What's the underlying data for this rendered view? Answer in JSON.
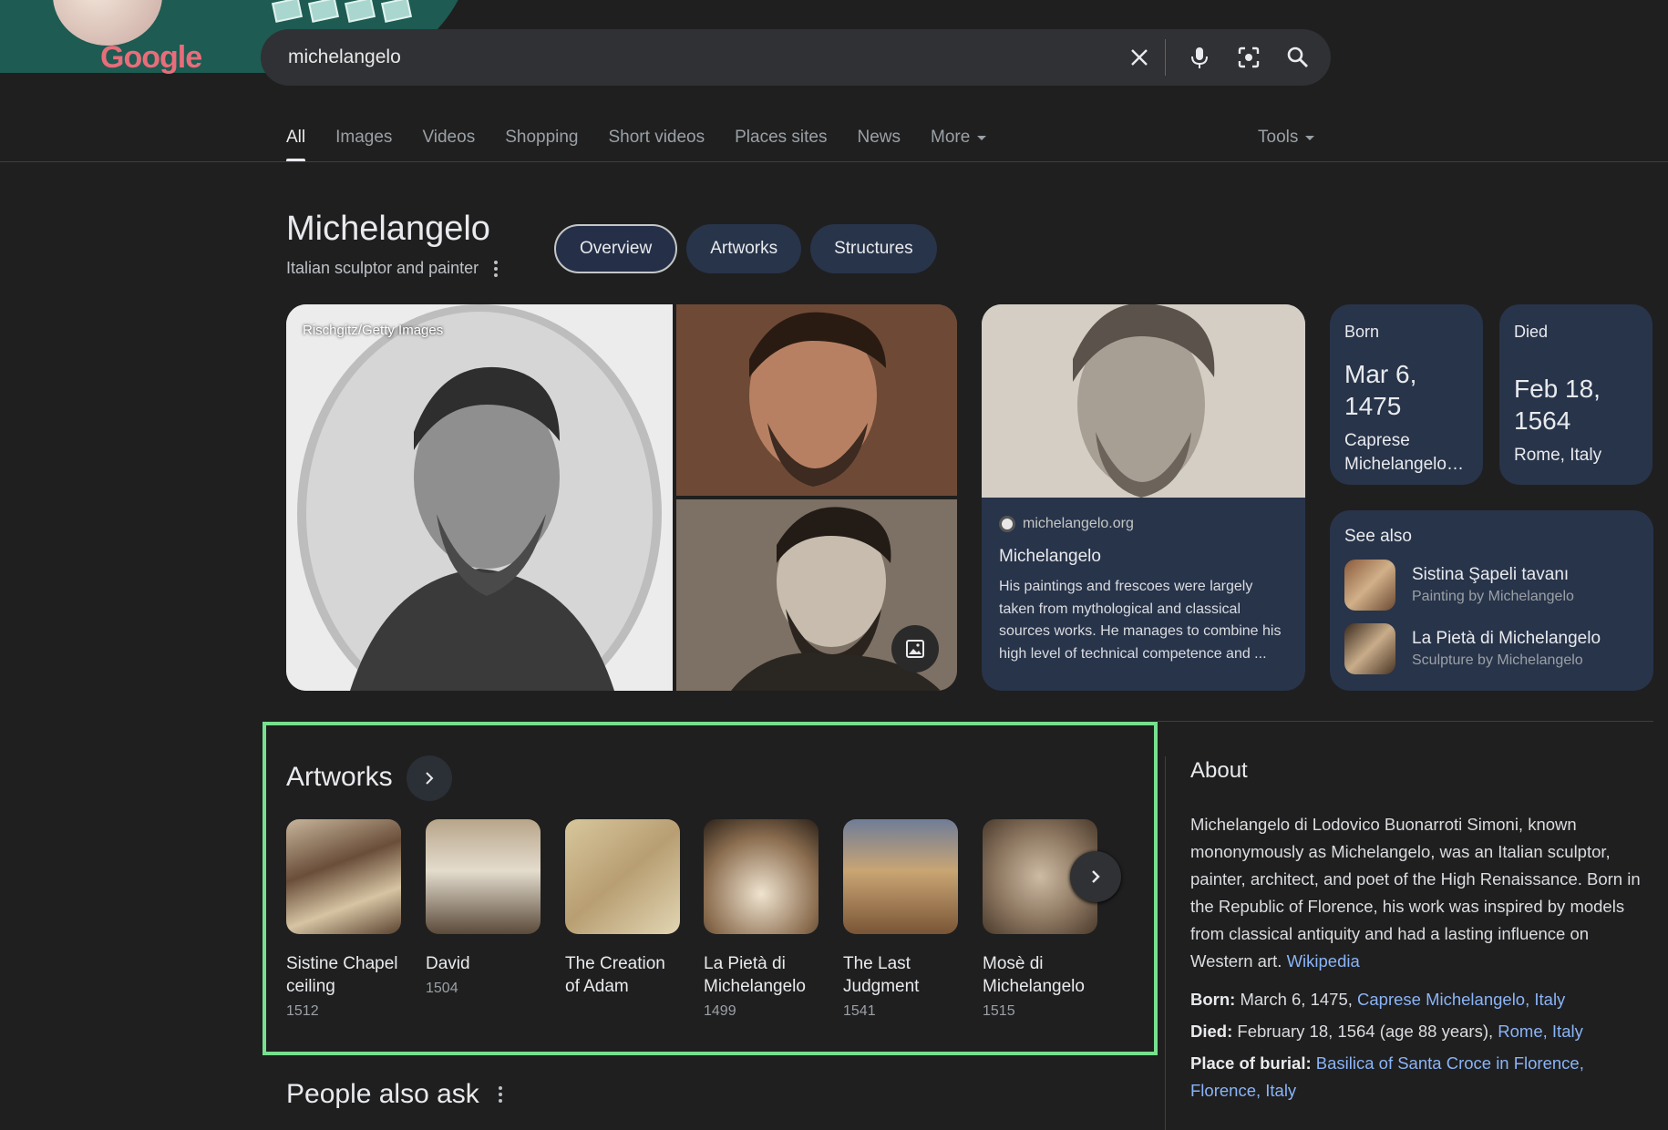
{
  "search": {
    "query": "michelangelo",
    "logo_text": "Google"
  },
  "tabs": [
    {
      "label": "All"
    },
    {
      "label": "Images"
    },
    {
      "label": "Videos"
    },
    {
      "label": "Shopping"
    },
    {
      "label": "Short videos"
    },
    {
      "label": "Places sites"
    },
    {
      "label": "News"
    },
    {
      "label": "More"
    }
  ],
  "tools_label": "Tools",
  "knowledge_panel": {
    "title": "Michelangelo",
    "subtitle": "Italian sculptor and painter",
    "chips": [
      {
        "label": "Overview"
      },
      {
        "label": "Artworks"
      },
      {
        "label": "Structures"
      }
    ],
    "photo_credit": "Rischgitz/Getty Images",
    "source": {
      "domain": "michelangelo.org",
      "title": "Michelangelo",
      "description": "His paintings and frescoes were largely taken from mythological and classical sources works. He manages to combine his high level of technical competence and ..."
    },
    "born": {
      "label": "Born",
      "date": "Mar 6, 1475",
      "place": "Caprese Michelangelo…"
    },
    "died": {
      "label": "Died",
      "date": "Feb 18, 1564",
      "place": "Rome, Italy"
    },
    "see_also": {
      "title": "See also",
      "items": [
        {
          "name": "Sistina Şapeli tavanı",
          "desc": "Painting by Michelangelo"
        },
        {
          "name": "La Pietà di Michelangelo",
          "desc": "Sculpture by Michelangelo"
        }
      ]
    }
  },
  "artworks": {
    "title": "Artworks",
    "items": [
      {
        "name": "Sistine Chapel ceiling",
        "year": "1512"
      },
      {
        "name": "David",
        "year": "1504"
      },
      {
        "name": "The Creation of Adam",
        "year": ""
      },
      {
        "name": "La Pietà di Michelangelo",
        "year": "1499"
      },
      {
        "name": "The Last Judgment",
        "year": "1541"
      },
      {
        "name": "Mosè di Michelangelo",
        "year": "1515"
      }
    ]
  },
  "people_also_ask": "People also ask",
  "about": {
    "title": "About",
    "text": "Michelangelo di Lodovico Buonarroti Simoni, known mononymously as Michelangelo, was an Italian sculptor, painter, architect, and poet of the High Renaissance. Born in the Republic of Florence, his work was inspired by models from classical antiquity and had a lasting influence on Western art.",
    "source_link": "Wikipedia",
    "born_label": "Born:",
    "born_text": "March 6, 1475,",
    "born_link": "Caprese Michelangelo, Italy",
    "died_label": "Died:",
    "died_text": "February 18, 1564 (age 88 years),",
    "died_link": "Rome, Italy",
    "burial_label": "Place of burial:",
    "burial_link": "Basilica of Santa Croce in Florence, Florence, Italy"
  },
  "colors": {
    "background": "#1f1f1f",
    "card": "#28344a",
    "link": "#8ab4f8",
    "highlight_box": "#77e08e"
  }
}
